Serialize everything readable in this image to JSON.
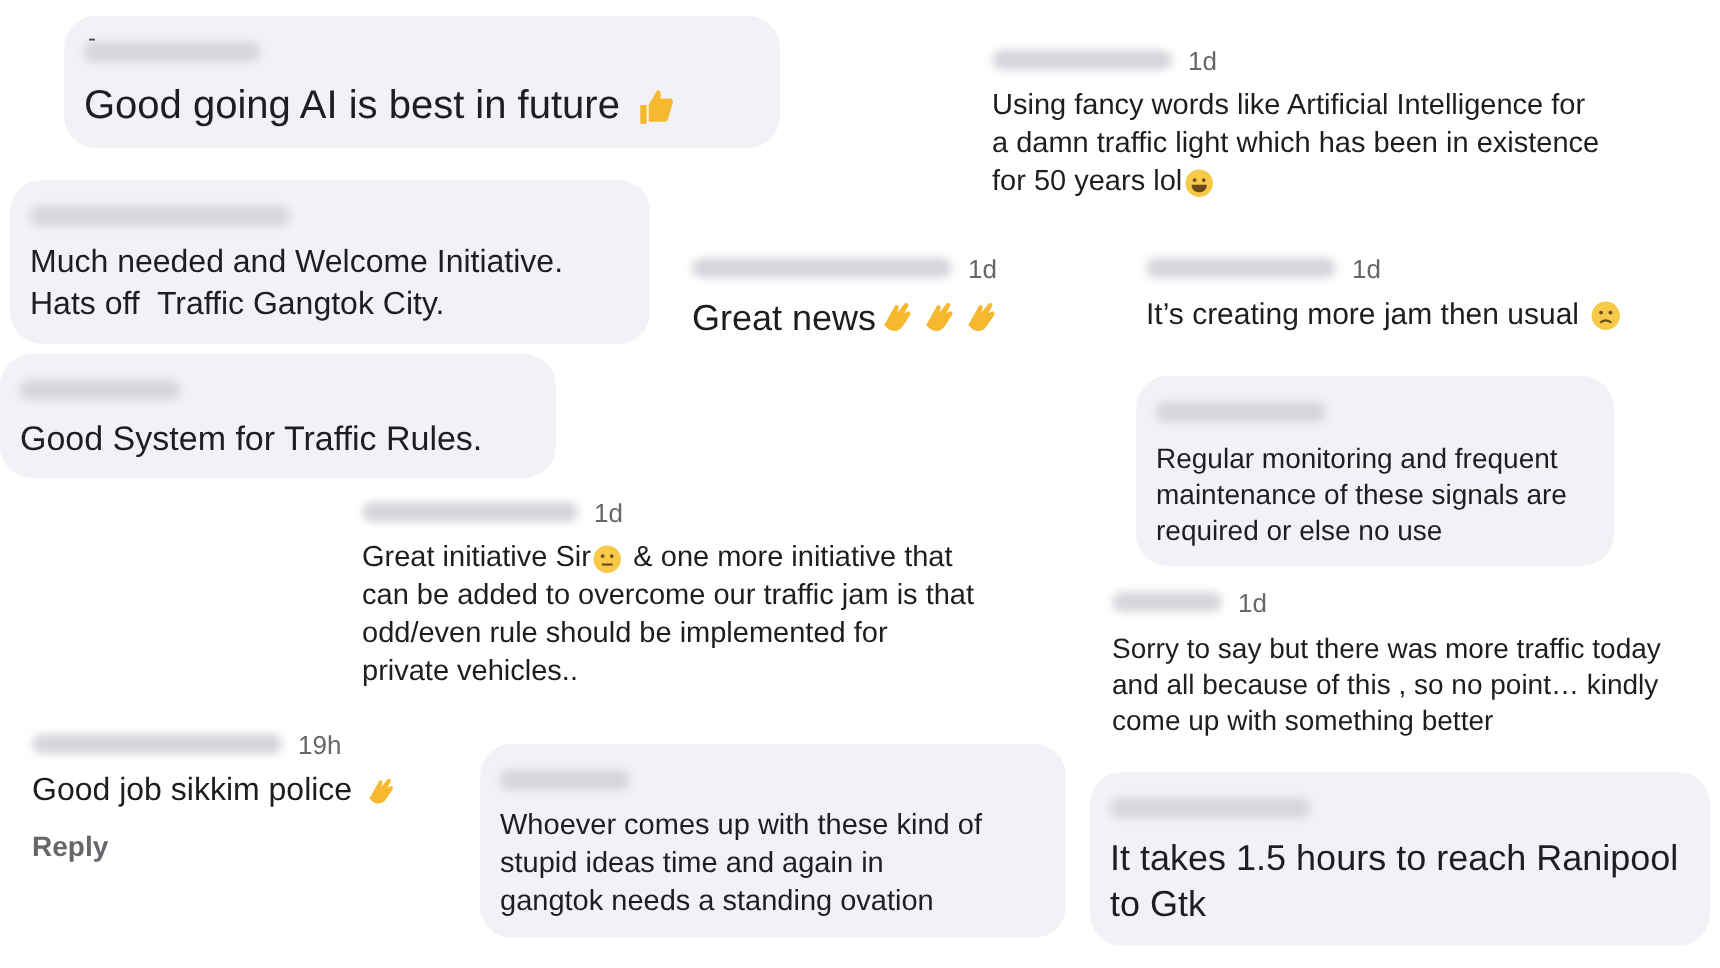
{
  "comments": [
    {
      "bubble": true,
      "prefix": "-",
      "rows": [
        [
          {
            "kind": "text",
            "text": "Good going AI is best in future "
          },
          {
            "kind": "thumbs-up"
          }
        ]
      ]
    },
    {
      "bubble": true,
      "rows": [
        [
          {
            "kind": "text",
            "text": "Much needed and Welcome Initiative.\nHats off  Traffic Gangtok City."
          }
        ]
      ]
    },
    {
      "bubble": true,
      "rows": [
        [
          {
            "kind": "text",
            "text": "Good System for Traffic Rules."
          }
        ]
      ]
    },
    {
      "bubble": false,
      "time": "1d",
      "rows": [
        [
          {
            "kind": "text",
            "text": "Great news"
          },
          {
            "kind": "clap"
          },
          {
            "kind": "clap"
          },
          {
            "kind": "clap"
          }
        ]
      ]
    },
    {
      "bubble": false,
      "time": "1d",
      "rows": [
        [
          {
            "kind": "text",
            "text": "Using fancy words like Artificial Intelligence for\na damn traffic light which has been in existence"
          }
        ],
        [
          {
            "kind": "text",
            "text": "for 50 years lol"
          },
          {
            "kind": "laugh"
          }
        ]
      ]
    },
    {
      "bubble": false,
      "time": "1d",
      "rows": [
        [
          {
            "kind": "text",
            "text": "It’s creating more jam then usual "
          },
          {
            "kind": "sad"
          }
        ]
      ]
    },
    {
      "bubble": true,
      "rows": [
        [
          {
            "kind": "text",
            "text": "Regular monitoring and frequent\nmaintenance of these signals are\nrequired or else no use"
          }
        ]
      ]
    },
    {
      "bubble": false,
      "time": "1d",
      "rows": [
        [
          {
            "kind": "text",
            "text": "Great initiative Sir"
          },
          {
            "kind": "neutral"
          },
          {
            "kind": "text",
            "text": " & one more initiative that"
          }
        ],
        [
          {
            "kind": "text",
            "text": "can be added to overcome our traffic jam is that\nodd/even rule should be implemented for\nprivate vehicles.."
          }
        ]
      ]
    },
    {
      "bubble": false,
      "time": "1d",
      "rows": [
        [
          {
            "kind": "text",
            "text": "Sorry to say but there was more traffic today\nand all because of this , so no point… kindly\ncome up with something better"
          }
        ]
      ]
    },
    {
      "bubble": false,
      "time": "19h",
      "reply": "Reply",
      "rows": [
        [
          {
            "kind": "text",
            "text": "Good job sikkim police "
          },
          {
            "kind": "clap"
          }
        ]
      ]
    },
    {
      "bubble": true,
      "rows": [
        [
          {
            "kind": "text",
            "text": "Whoever comes up with these kind of\nstupid ideas time and again in\ngangtok needs a standing ovation"
          }
        ]
      ]
    },
    {
      "bubble": true,
      "rows": [
        [
          {
            "kind": "text",
            "text": "It takes 1.5 hours to reach Ranipool\nto Gtk"
          }
        ]
      ]
    }
  ]
}
